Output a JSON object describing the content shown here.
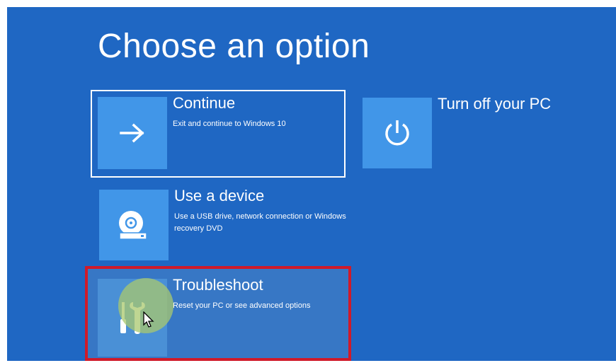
{
  "page": {
    "title": "Choose an option"
  },
  "options": {
    "continue": {
      "label": "Continue",
      "description": "Exit and continue to Windows 10",
      "icon": "arrow-right-icon"
    },
    "use_device": {
      "label": "Use a device",
      "description": "Use a USB drive, network connection or Windows recovery DVD",
      "icon": "disc-drive-icon"
    },
    "troubleshoot": {
      "label": "Troubleshoot",
      "description": "Reset your PC or see advanced options",
      "icon": "tools-icon"
    },
    "turn_off": {
      "label": "Turn off your PC",
      "icon": "power-icon"
    }
  },
  "colors": {
    "background": "#1f67c3",
    "tile": "#4196e8",
    "highlight_border": "#d01a2a",
    "selection_border": "#ffffff"
  }
}
